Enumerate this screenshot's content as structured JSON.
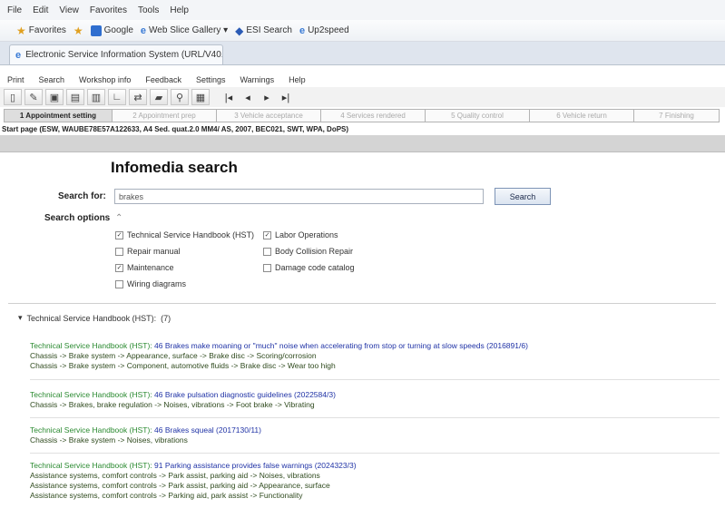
{
  "browser": {
    "menu": [
      "File",
      "Edit",
      "View",
      "Favorites",
      "Tools",
      "Help"
    ],
    "favorites_label": "Favorites",
    "favorites": [
      "Google",
      "Web Slice Gallery ▾",
      "ESI Search",
      "Up2speed"
    ],
    "tab_title": "Electronic Service Information System (URL/V40..."
  },
  "app": {
    "menu": [
      "Print",
      "Search",
      "Workshop info",
      "Feedback",
      "Settings",
      "Warnings",
      "Help"
    ],
    "steps": [
      "1 Appointment setting",
      "2 Appointment prep",
      "3 Vehicle acceptance",
      "4 Services rendered",
      "5 Quality control",
      "6 Vehicle return",
      "7 Finishing"
    ],
    "status_line": "Start page (ESW, WAUBE78E57A122633, A4 Sed. quat.2.0 MM4/ AS, 2007, BEC021, SWT, WPA, DoPS)"
  },
  "search": {
    "title": "Infomedia search",
    "label": "Search for:",
    "value": "brakes",
    "button": "Search",
    "options_label": "Search options",
    "options": [
      {
        "label": "Technical Service Handbook (HST)",
        "checked": true
      },
      {
        "label": "Labor Operations",
        "checked": true
      },
      {
        "label": "Repair manual",
        "checked": false
      },
      {
        "label": "Body Collision Repair",
        "checked": false
      },
      {
        "label": "Maintenance",
        "checked": true
      },
      {
        "label": "Damage code catalog",
        "checked": false
      },
      {
        "label": "Wiring diagrams",
        "checked": false
      }
    ]
  },
  "results": {
    "header_toggle": "▾",
    "header_label": "Technical Service Handbook (HST):",
    "header_count": "(7)",
    "items": [
      {
        "source": "Technical Service Handbook (HST):",
        "title": "46 Brakes make moaning or \"much\" noise when accelerating from stop or turning at slow speeds (2016891/6)",
        "paths": [
          "Chassis -> Brake system -> Appearance, surface -> Brake disc -> Scoring/corrosion",
          "Chassis -> Brake system -> Component, automotive fluids -> Brake disc -> Wear too high"
        ]
      },
      {
        "source": "Technical Service Handbook (HST):",
        "title": "46 Brake pulsation diagnostic guidelines (2022584/3)",
        "paths": [
          "Chassis -> Brakes, brake regulation -> Noises, vibrations -> Foot brake -> Vibrating"
        ]
      },
      {
        "source": "Technical Service Handbook (HST):",
        "title": "46 Brakes squeal (2017130/11)",
        "paths": [
          "Chassis -> Brake system -> Noises, vibrations"
        ]
      },
      {
        "source": "Technical Service Handbook (HST):",
        "title": "91 Parking assistance provides false warnings (2024323/3)",
        "paths": [
          "Assistance systems, comfort controls -> Park assist, parking aid -> Noises, vibrations",
          "Assistance systems, comfort controls -> Park assist, parking aid -> Appearance, surface",
          "Assistance systems, comfort controls -> Parking aid, park assist -> Functionality"
        ]
      }
    ]
  }
}
